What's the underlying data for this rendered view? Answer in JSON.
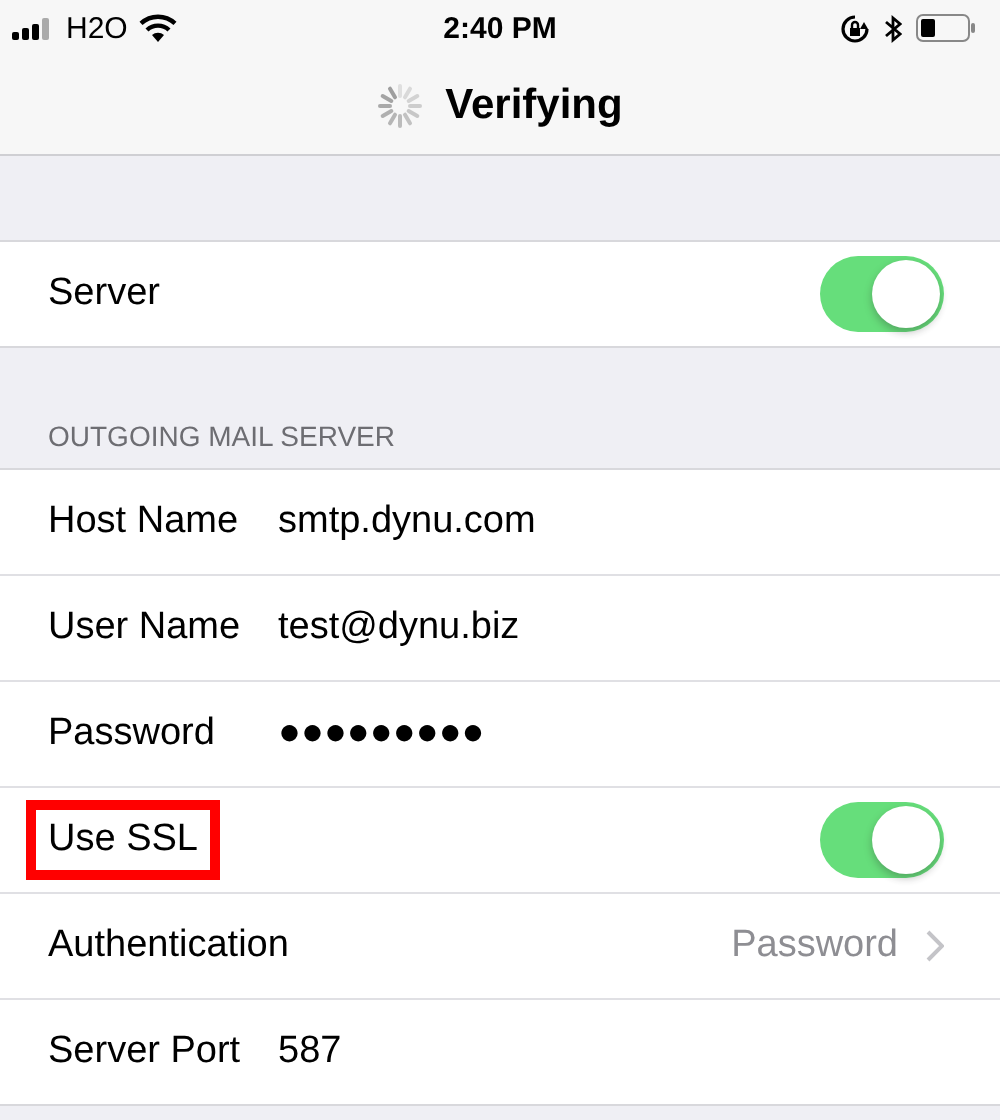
{
  "status_bar": {
    "carrier": "H2O",
    "time": "2:40 PM"
  },
  "nav": {
    "title": "Verifying",
    "loading": true
  },
  "top_section": {
    "rows": [
      {
        "kind": "toggle",
        "label": "Server",
        "on": true,
        "highlighted": false
      }
    ]
  },
  "outgoing_section": {
    "header": "OUTGOING MAIL SERVER",
    "rows": [
      {
        "kind": "value",
        "label": "Host Name",
        "value": "smtp.dynu.com",
        "highlighted": false
      },
      {
        "kind": "value",
        "label": "User Name",
        "value": "test@dynu.biz",
        "highlighted": false
      },
      {
        "kind": "value",
        "label": "Password",
        "value": "●●●●●●●●●",
        "highlighted": false
      },
      {
        "kind": "toggle",
        "label": "Use SSL",
        "on": true,
        "highlighted": true
      },
      {
        "kind": "disclosure",
        "label": "Authentication",
        "value": "Password",
        "highlighted": false
      },
      {
        "kind": "value",
        "label": "Server Port",
        "value": "587",
        "highlighted": false
      }
    ]
  }
}
